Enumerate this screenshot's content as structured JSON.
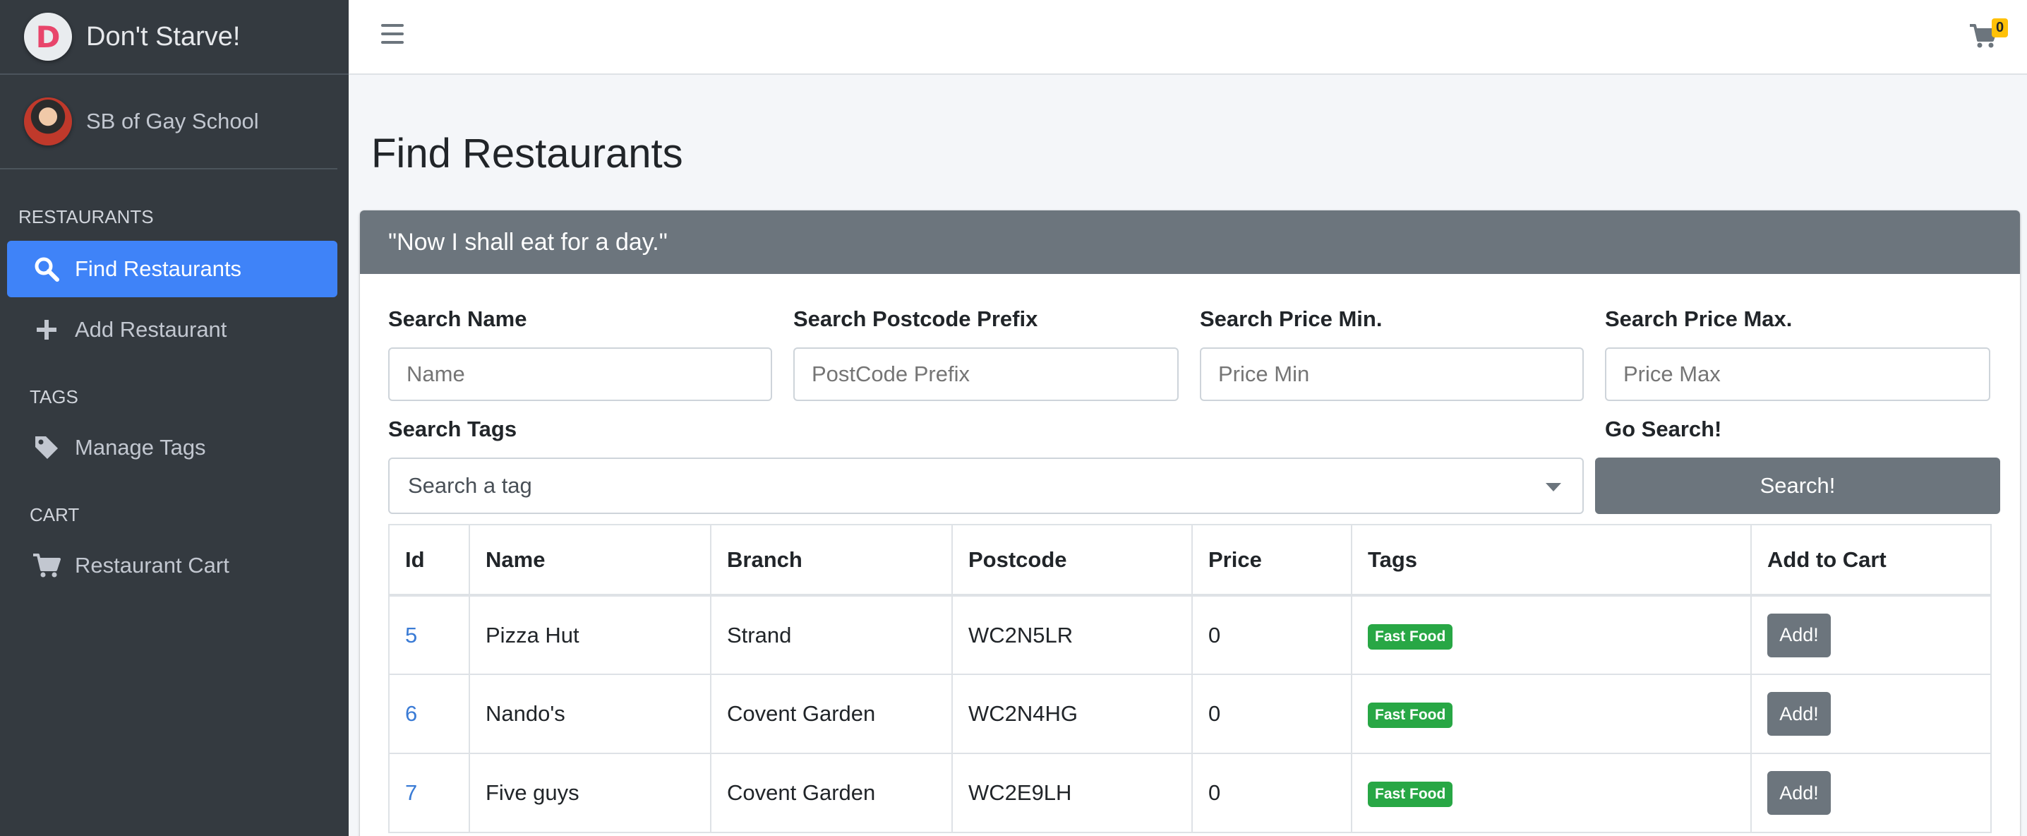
{
  "brand": {
    "logo_letter": "D",
    "name": "Don't Starve!"
  },
  "user": {
    "name": "SB of Gay School"
  },
  "sidebar": {
    "sections": [
      {
        "header": "RESTAURANTS",
        "items": [
          {
            "label": "Find Restaurants",
            "icon": "search-icon",
            "active": true
          },
          {
            "label": "Add Restaurant",
            "icon": "plus-icon",
            "active": false
          }
        ]
      },
      {
        "header": "TAGS",
        "items": [
          {
            "label": "Manage Tags",
            "icon": "tag-icon",
            "active": false
          }
        ]
      },
      {
        "header": "CART",
        "items": [
          {
            "label": "Restaurant Cart",
            "icon": "cart-icon",
            "active": false
          }
        ]
      }
    ]
  },
  "topbar": {
    "cart_count": "0"
  },
  "page": {
    "title": "Find Restaurants"
  },
  "card": {
    "header": "\"Now I shall eat for a day.\""
  },
  "search": {
    "name_label": "Search Name",
    "name_placeholder": "Name",
    "postcode_label": "Search Postcode Prefix",
    "postcode_placeholder": "PostCode Prefix",
    "price_min_label": "Search Price Min.",
    "price_min_placeholder": "Price Min",
    "price_max_label": "Search Price Max.",
    "price_max_placeholder": "Price Max",
    "tags_label": "Search Tags",
    "tags_placeholder": "Search a tag",
    "go_label": "Go Search!",
    "button_label": "Search!"
  },
  "table": {
    "headers": [
      "Id",
      "Name",
      "Branch",
      "Postcode",
      "Price",
      "Tags",
      "Add to Cart"
    ],
    "rows": [
      {
        "id": "5",
        "name": "Pizza Hut",
        "branch": "Strand",
        "postcode": "WC2N5LR",
        "price": "0",
        "tag": "Fast Food",
        "action": "Add!"
      },
      {
        "id": "6",
        "name": "Nando's",
        "branch": "Covent Garden",
        "postcode": "WC2N4HG",
        "price": "0",
        "tag": "Fast Food",
        "action": "Add!"
      },
      {
        "id": "7",
        "name": "Five guys",
        "branch": "Covent Garden",
        "postcode": "WC2E9LH",
        "price": "0",
        "tag": "Fast Food",
        "action": "Add!"
      }
    ]
  },
  "colors": {
    "sidebar_bg": "#343a40",
    "active": "#3f83f8",
    "header_bg": "#6c757d",
    "badge": "#28a745",
    "cart_badge": "#ffc107"
  }
}
